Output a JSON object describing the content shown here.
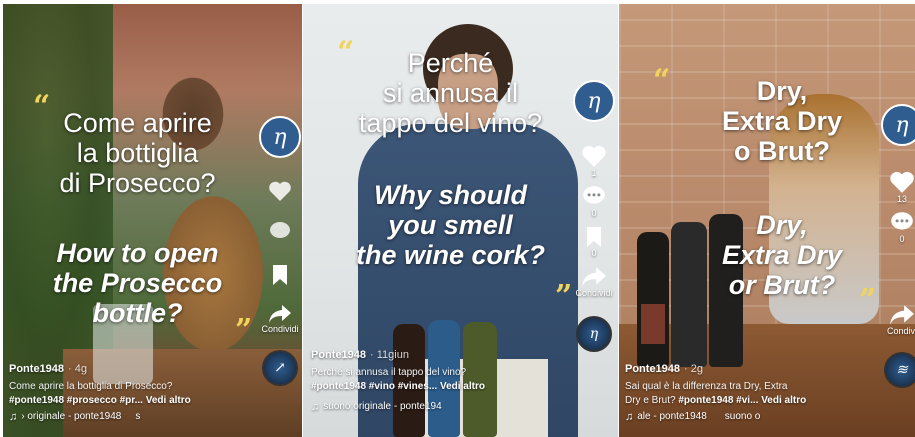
{
  "colors": {
    "quote": "#f1d45a",
    "logo_blue": "#2f5d8f",
    "text": "#ffffff"
  },
  "panels": [
    {
      "overlay_it": [
        "Come aprire",
        "la bottiglia",
        "di Prosecco?"
      ],
      "overlay_en": [
        "How to open",
        "the Prosecco",
        "bottle?"
      ],
      "logo_letter": "η",
      "share_label": "Condividi",
      "author": "Ponte1948",
      "time": "· 4g",
      "caption": "Come aprire la bottiglia di Prosecco?",
      "tags": "#ponte1948 #prosecco #pr...",
      "more": "Vedi altro",
      "sound": "› originale - ponte1948",
      "sound_suffix": "s"
    },
    {
      "overlay_it": [
        "Perché",
        "si annusa il",
        "tappo del vino?"
      ],
      "overlay_en": [
        "Why should",
        "you smell",
        "the wine cork?"
      ],
      "logo_letter": "η",
      "like_count": "1",
      "comment_count": "0",
      "save_count": "0",
      "share_label": "Condividi",
      "author": "Ponte1948",
      "time": "· 11giun",
      "caption": "Perché si annusa il tappo del vino?",
      "tags": "#ponte1948 #vino #vines...",
      "more": "Vedi altro",
      "sound": "suono originale - ponte194"
    },
    {
      "overlay_it": [
        "Dry,",
        "Extra Dry",
        "o Brut?"
      ],
      "overlay_en": [
        "Dry,",
        "Extra Dry",
        "or Brut?"
      ],
      "logo_letter": "η",
      "like_count": "13",
      "comment_count": "0",
      "share_label": "Condivi",
      "author": "Ponte1948",
      "time": "· 2g",
      "caption": "Sai qual è la differenza tra Dry, Extra",
      "caption2": "Dry e Brut?",
      "tags": "#ponte1948 #vi...",
      "more": "Vedi altro",
      "sound": "ale - ponte1948",
      "sound_suffix": "suono o"
    }
  ]
}
